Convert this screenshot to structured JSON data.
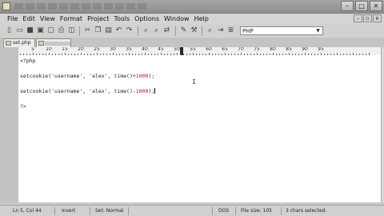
{
  "window": {
    "title": "",
    "controls": {
      "minimize": "–",
      "maximize": "□",
      "close": "✕"
    }
  },
  "menu": {
    "items": [
      "File",
      "Edit",
      "View",
      "Format",
      "Project",
      "Tools",
      "Options",
      "Window",
      "Help"
    ],
    "mdi": {
      "minimize": "–",
      "restore": "▫",
      "close": "x"
    }
  },
  "toolbar": {
    "language": "PHP"
  },
  "tabs": [
    {
      "label": "set.php"
    },
    {
      "label": ""
    }
  ],
  "ruler": {
    "marks": [
      "5",
      "10",
      "15",
      "20",
      "25",
      "30",
      "35",
      "40",
      "45",
      "50",
      "55",
      "60",
      "65",
      "70",
      "75",
      "80",
      "85",
      "90",
      "95"
    ]
  },
  "editor": {
    "lines": [
      {
        "segments": [
          {
            "text": "<?php",
            "color": "normal"
          }
        ]
      },
      {
        "segments": [
          {
            "text": "",
            "color": "normal"
          }
        ]
      },
      {
        "segments": [
          {
            "text": "setcookie('username', 'alex', time()+",
            "color": "normal"
          },
          {
            "text": "1000",
            "color": "red"
          },
          {
            "text": ");",
            "color": "normal"
          }
        ]
      },
      {
        "segments": [
          {
            "text": "",
            "color": "normal"
          }
        ]
      },
      {
        "segments": [
          {
            "text": "setcookie('username', 'alex', time()-",
            "color": "normal"
          },
          {
            "text": "1000",
            "color": "red"
          },
          {
            "text": ");",
            "color": "normal"
          }
        ]
      },
      {
        "segments": [
          {
            "text": "",
            "color": "normal"
          }
        ]
      },
      {
        "segments": [
          {
            "text": "?>",
            "color": "normal"
          }
        ]
      }
    ],
    "colors": {
      "normal": "#1a1a1a",
      "red": "#c01010"
    }
  },
  "status": {
    "position": "Ln 5, Col 44",
    "mode": "Insert",
    "syntax": "Set: Normal",
    "line_ending": "DOS",
    "file_size": "File size: 105",
    "selection": "3 chars selected."
  }
}
